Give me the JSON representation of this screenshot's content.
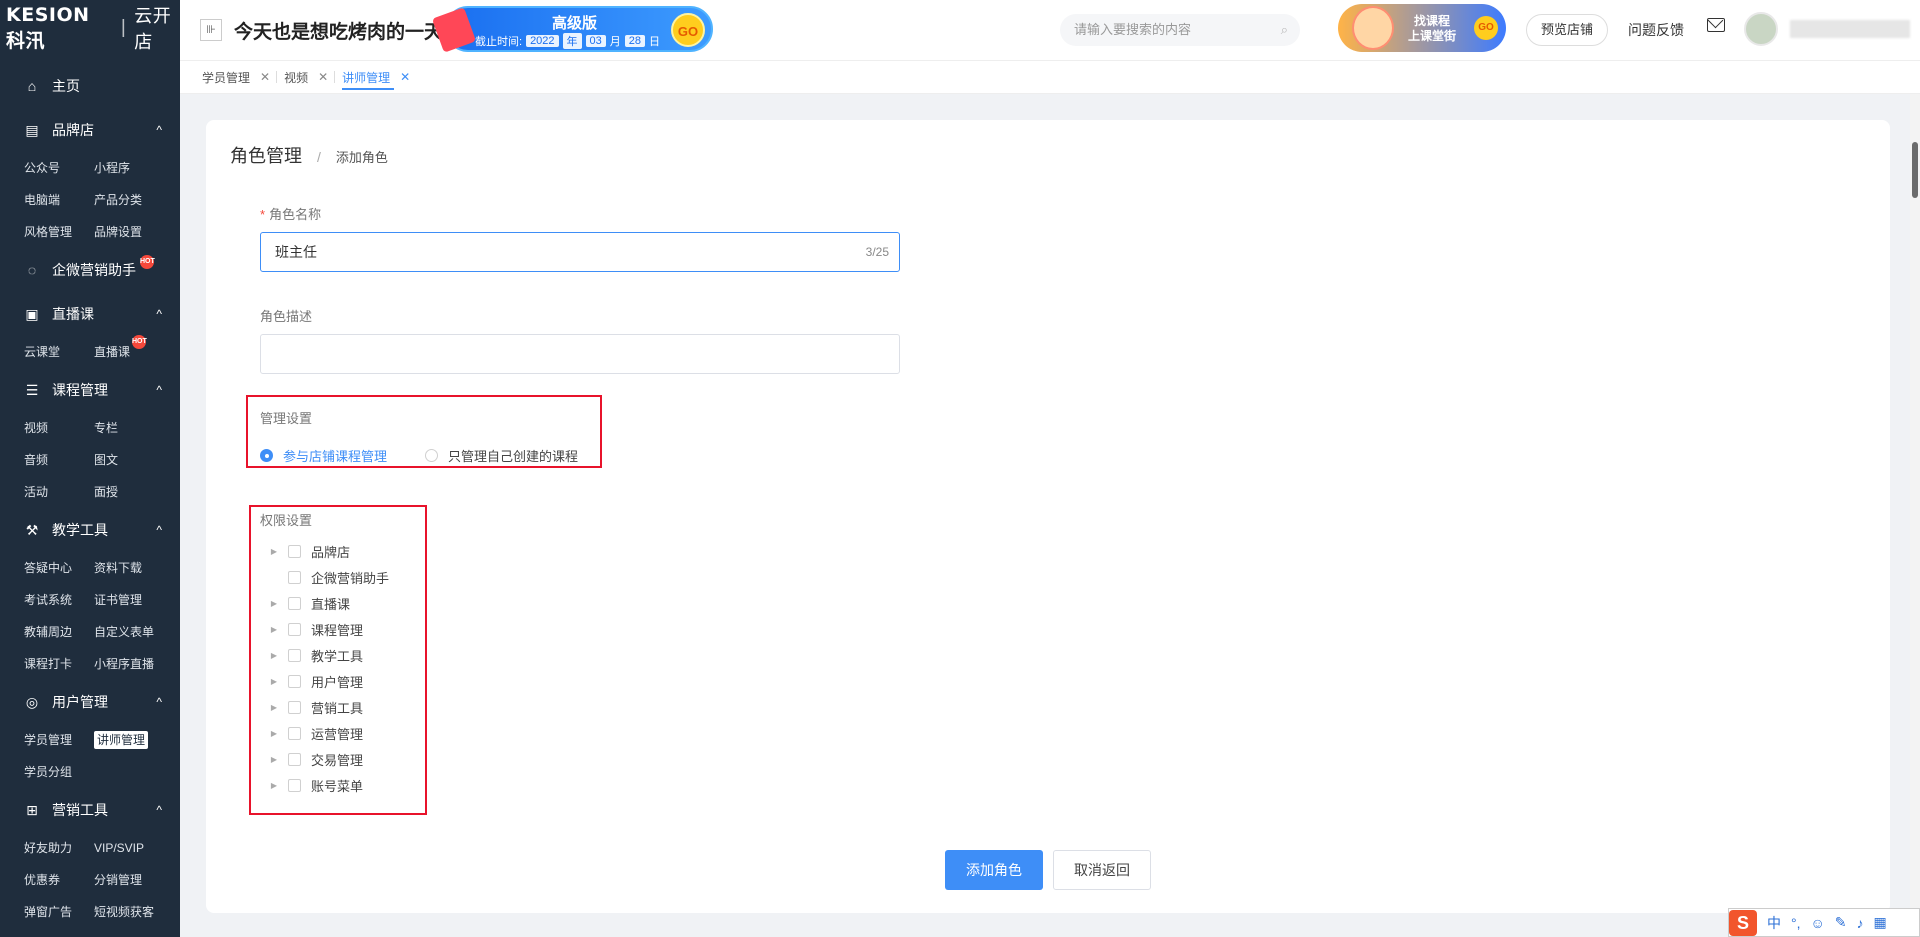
{
  "brand": {
    "logo": "KESION 科汛",
    "store": "云开店"
  },
  "sidebar": {
    "home": "主页",
    "groups": [
      {
        "label": "品牌店",
        "items": [
          "公众号",
          "小程序",
          "电脑端",
          "产品分类",
          "风格管理",
          "品牌设置"
        ]
      },
      {
        "label": "企微营销助手",
        "hot": "HOT"
      },
      {
        "label": "直播课",
        "items": [
          "云课堂",
          "直播课"
        ],
        "hot_item": "HOT"
      },
      {
        "label": "课程管理",
        "items": [
          "视频",
          "专栏",
          "音频",
          "图文",
          "活动",
          "面授"
        ]
      },
      {
        "label": "教学工具",
        "items": [
          "答疑中心",
          "资料下载",
          "考试系统",
          "证书管理",
          "教辅周边",
          "自定义表单",
          "课程打卡",
          "小程序直播"
        ]
      },
      {
        "label": "用户管理",
        "items": [
          "学员管理",
          "讲师管理",
          "学员分组"
        ],
        "active_item": "讲师管理"
      },
      {
        "label": "营销工具",
        "items": [
          "好友助力",
          "VIP/SVIP",
          "优惠券",
          "分销管理",
          "弹窗广告",
          "短视频获客"
        ]
      }
    ]
  },
  "header": {
    "slogan": "今天也是想吃烤肉的一天",
    "plan": {
      "tier": "高级版",
      "expiry_label": "截止时间:",
      "year": "2022",
      "year_unit": "年",
      "month": "03",
      "month_unit": "月",
      "day": "28",
      "day_unit": "日",
      "go": "GO"
    },
    "search_placeholder": "请输入要搜索的内容",
    "course_banner": {
      "line1": "找课程",
      "line2": "上课堂街",
      "go": "GO"
    },
    "preview": "预览店铺",
    "feedback": "问题反馈"
  },
  "tabs": [
    {
      "label": "学员管理"
    },
    {
      "label": "视频"
    },
    {
      "label": "讲师管理"
    }
  ],
  "page": {
    "breadcrumb": {
      "title": "角色管理",
      "sep": "/",
      "current": "添加角色"
    },
    "role_name": {
      "label": "角色名称",
      "required_mark": "*",
      "value": "班主任",
      "counter": "3/25"
    },
    "role_desc": {
      "label": "角色描述",
      "value": ""
    },
    "management": {
      "label": "管理设置",
      "options": [
        "参与店铺课程管理",
        "只管理自己创建的课程"
      ],
      "selected": "参与店铺课程管理"
    },
    "permissions": {
      "label": "权限设置",
      "items": [
        {
          "label": "品牌店",
          "expandable": true
        },
        {
          "label": "企微营销助手",
          "expandable": false
        },
        {
          "label": "直播课",
          "expandable": true
        },
        {
          "label": "课程管理",
          "expandable": true
        },
        {
          "label": "教学工具",
          "expandable": true
        },
        {
          "label": "用户管理",
          "expandable": true
        },
        {
          "label": "营销工具",
          "expandable": true
        },
        {
          "label": "运营管理",
          "expandable": true
        },
        {
          "label": "交易管理",
          "expandable": true
        },
        {
          "label": "账号菜单",
          "expandable": true
        }
      ]
    },
    "buttons": {
      "submit": "添加角色",
      "cancel": "取消返回"
    }
  },
  "ime": {
    "lang": "中",
    "punct": "°,",
    "logo": "S"
  },
  "colors": {
    "primary": "#3e8ef7",
    "sidebar": "#1f2d3d",
    "highlight_border": "#e8132b"
  }
}
